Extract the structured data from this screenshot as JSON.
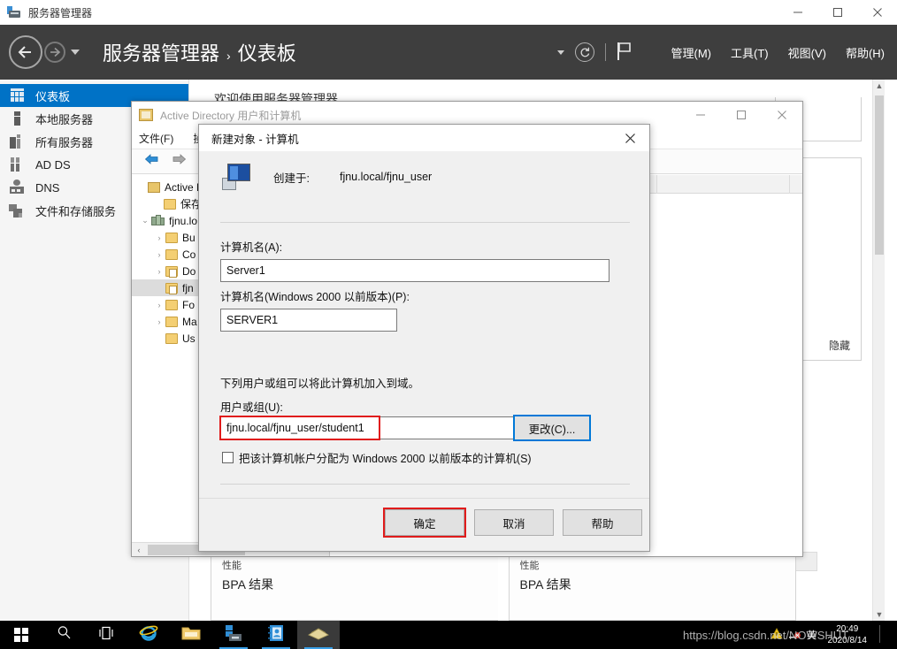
{
  "server_manager": {
    "window_title": "服务器管理器",
    "breadcrumb": {
      "root": "服务器管理器",
      "separator": "›",
      "current": "仪表板"
    },
    "window_buttons": {
      "minimize": "—",
      "maximize": "□",
      "close": "✕"
    },
    "header_menus": [
      {
        "label": "管理(M)"
      },
      {
        "label": "工具(T)"
      },
      {
        "label": "视图(V)"
      },
      {
        "label": "帮助(H)"
      }
    ],
    "header_icons": {
      "dropdown": "chevron-down-icon",
      "refresh": "refresh-icon",
      "notifications": "flag-icon"
    },
    "sidebar": [
      {
        "label": "仪表板",
        "icon": "dashboard-icon",
        "active": true
      },
      {
        "label": "本地服务器",
        "icon": "local-server-icon",
        "active": false
      },
      {
        "label": "所有服务器",
        "icon": "all-servers-icon",
        "active": false
      },
      {
        "label": "AD DS",
        "icon": "ad-ds-icon",
        "active": false
      },
      {
        "label": "DNS",
        "icon": "dns-icon",
        "active": false
      },
      {
        "label": "文件和存储服务",
        "icon": "file-storage-icon",
        "active": false
      }
    ],
    "welcome_title": "欢迎使用服务器管理器",
    "hide_link": "隐藏",
    "tiles": [
      {
        "sub": "性能",
        "main": "BPA 结果"
      },
      {
        "sub": "性能",
        "main": "BPA 结果"
      }
    ]
  },
  "aduc": {
    "window_title": "Active Directory 用户和计算机",
    "window_buttons": {
      "minimize": "—",
      "maximize": "□",
      "close": "✕"
    },
    "menus": [
      {
        "label": "文件(F)"
      },
      {
        "label": "操作"
      }
    ],
    "toolbar_icons": [
      "back-arrow-icon",
      "forward-arrow-icon",
      "up-folder-icon"
    ],
    "tree": [
      {
        "label": "Active Directory",
        "icon": "console-root-icon",
        "indent": 0,
        "twisty": "",
        "selected": false
      },
      {
        "label": "保存的",
        "icon": "folder-icon",
        "indent": 1,
        "twisty": "",
        "selected": false
      },
      {
        "label": "fjnu.lo",
        "icon": "domain-icon",
        "indent": 0,
        "twisty": "⌄",
        "selected": false
      },
      {
        "label": "Bu",
        "icon": "folder-icon",
        "indent": 2,
        "twisty": "›",
        "selected": false
      },
      {
        "label": "Co",
        "icon": "folder-icon",
        "indent": 2,
        "twisty": "›",
        "selected": false
      },
      {
        "label": "Do",
        "icon": "folder-doc-icon",
        "indent": 2,
        "twisty": "›",
        "selected": false
      },
      {
        "label": "fjn",
        "icon": "folder-doc-icon",
        "indent": 2,
        "twisty": "",
        "selected": true
      },
      {
        "label": "Fo",
        "icon": "folder-icon",
        "indent": 2,
        "twisty": "›",
        "selected": false
      },
      {
        "label": "Ma",
        "icon": "folder-icon",
        "indent": 2,
        "twisty": "›",
        "selected": false
      },
      {
        "label": "Us",
        "icon": "folder-icon",
        "indent": 2,
        "twisty": "",
        "selected": false
      }
    ],
    "hscroll_arrow": "‹"
  },
  "dialog": {
    "title": "新建对象 - 计算机",
    "close_label": "✕",
    "icon": "computer-icon",
    "created_in_label": "创建于:",
    "created_in_value": "fjnu.local/fjnu_user",
    "computer_name_label": "计算机名(A):",
    "computer_name_value": "Server1",
    "computer_name_placeholder": "",
    "pre2000_label": "计算机名(Windows 2000 以前版本)(P):",
    "pre2000_value": "SERVER1",
    "helper_text": "下列用户或组可以将此计算机加入到域。",
    "user_group_label": "用户或组(U):",
    "user_group_value": "fjnu.local/fjnu_user/student1",
    "change_button": "更改(C)...",
    "checkbox_label": "把该计算机帐户分配为 Windows 2000 以前版本的计算机(S)",
    "checkbox_checked": false,
    "buttons": {
      "ok": "确定",
      "cancel": "取消",
      "help": "帮助"
    },
    "highlight_color": "#e01b1b",
    "focus_color": "#0078d7"
  },
  "taskbar": {
    "items": [
      {
        "name": "start-button",
        "icon": "windows-logo-icon"
      },
      {
        "name": "search-button",
        "icon": "search-icon"
      },
      {
        "name": "task-view-button",
        "icon": "task-view-icon"
      },
      {
        "name": "internet-explorer",
        "icon": "ie-icon"
      },
      {
        "name": "file-explorer",
        "icon": "folder-icon"
      },
      {
        "name": "server-manager",
        "icon": "server-manager-icon"
      },
      {
        "name": "aduc",
        "icon": "aduc-icon"
      },
      {
        "name": "new-object-dialog",
        "icon": "dialog-icon"
      }
    ],
    "clock": {
      "time": "20:49",
      "date": "2020/8/14"
    },
    "watermark": "https://blog.csdn.net/NOWSHUT"
  }
}
